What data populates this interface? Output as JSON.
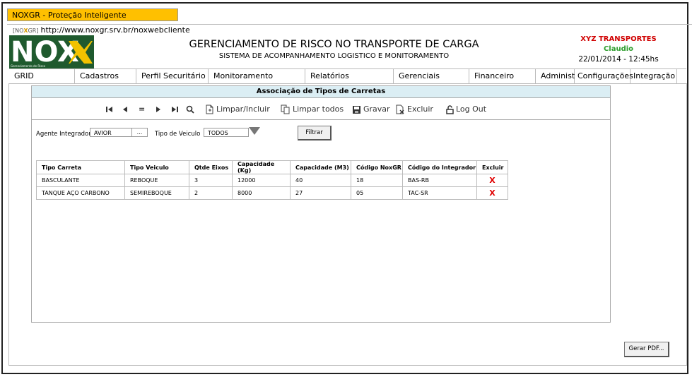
{
  "window": {
    "title": "NOXGR - Proteção Inteligente"
  },
  "browser": {
    "url_prefix_1": "[NO",
    "url_prefix_2": "X",
    "url_prefix_3": "GR]",
    "url": "http://www.noxgr.srv.br/noxwebcliente"
  },
  "logo": {
    "text": "NOX",
    "tagline": "Gerenciamento de Risco"
  },
  "header": {
    "title": "GERENCIAMENTO DE RISCO NO TRANSPORTE DE CARGA",
    "subtitle": "SISTEMA DE ACOMPANHAMENTO LOGISTICO  E MONITORAMENTO",
    "company": "XYZ TRANSPORTES",
    "user": "Claudio",
    "datetime": "22/01/2014 - 12:45hs"
  },
  "menu": [
    {
      "label": "GRID"
    },
    {
      "label": "Cadastros"
    },
    {
      "label": "Perfil Securitário"
    },
    {
      "label": "Monitoramento"
    },
    {
      "label": "Relatórios"
    },
    {
      "label": "Gerenciais"
    },
    {
      "label": "Financeiro"
    },
    {
      "label": "Administ"
    },
    {
      "label": "Configurações"
    },
    {
      "label": "Integração"
    }
  ],
  "panel": {
    "title": "Associação de Tipos de Carretas"
  },
  "toolbar": {
    "clear_include": "Limpar/Incluir",
    "clear_all": "Limpar todos",
    "save": "Gravar",
    "delete": "Excluir",
    "logout": "Log Out",
    "equals": "="
  },
  "filters": {
    "agent_label": "Agente Integrador",
    "agent_value": "AVIOR",
    "agent_lookup": "...",
    "vehicle_label": "Tipo de Veiculo",
    "vehicle_value": "TODOS",
    "filter_button": "Filtrar"
  },
  "table": {
    "columns": [
      "Tipo Carreta",
      "Tipo Veiculo",
      "Qtde Eixos",
      "Capacidade (Kg)",
      "Capacidade (M3)",
      "Código NoxGR",
      "Código do Integrador",
      "Excluir"
    ],
    "rows": [
      [
        "BASCULANTE",
        "REBOQUE",
        "3",
        "12000",
        "40",
        "18",
        "BAS-RB",
        "X"
      ],
      [
        "TANQUE AÇO CARBONO",
        "SEMIREBOQUE",
        "2",
        "8000",
        "27",
        "05",
        "TAC-SR",
        "X"
      ]
    ]
  },
  "footer": {
    "pdf_button": "Gerar PDF..."
  },
  "colors": {
    "title_bar": "#ffc000",
    "company": "#d00000",
    "user": "#2e9e2e",
    "panel_header": "#dbeef4",
    "delete_x": "#e00000",
    "logo_bg": "#1f5a2e",
    "logo_accent": "#f2c200"
  }
}
